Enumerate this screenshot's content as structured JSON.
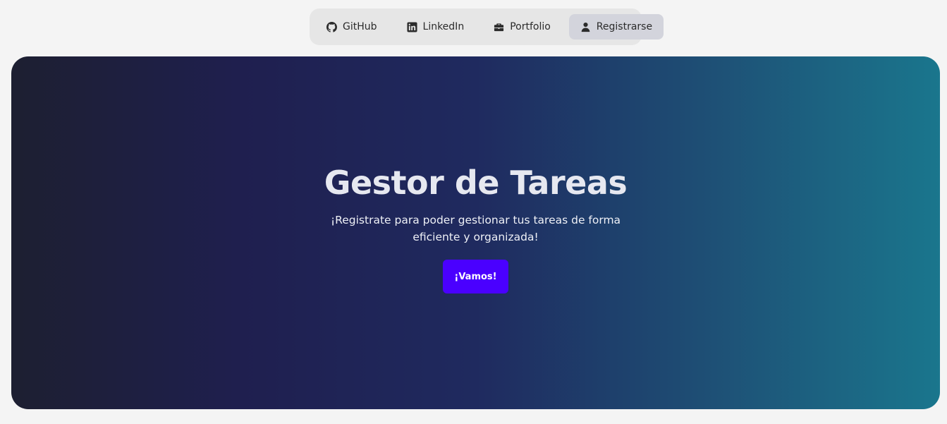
{
  "nav": {
    "items": [
      {
        "label": "GitHub",
        "icon": "github-icon"
      },
      {
        "label": "LinkedIn",
        "icon": "linkedin-icon"
      },
      {
        "label": "Portfolio",
        "icon": "briefcase-icon"
      },
      {
        "label": "Registrarse",
        "icon": "user-icon",
        "active": true
      }
    ]
  },
  "hero": {
    "title": "Gestor de Tareas",
    "subtitle": "¡Registrate para poder gestionar tus tareas de forma eficiente y organizada!",
    "button_label": "¡Vamos!"
  },
  "colors": {
    "page_background": "#f4f4f4",
    "nav_background": "#e6e6e6",
    "nav_active_background": "#d3d4dc",
    "hero_gradient_start": "#1d1f31",
    "hero_gradient_end": "#1a768d",
    "button_accent": "#4a00ff"
  }
}
